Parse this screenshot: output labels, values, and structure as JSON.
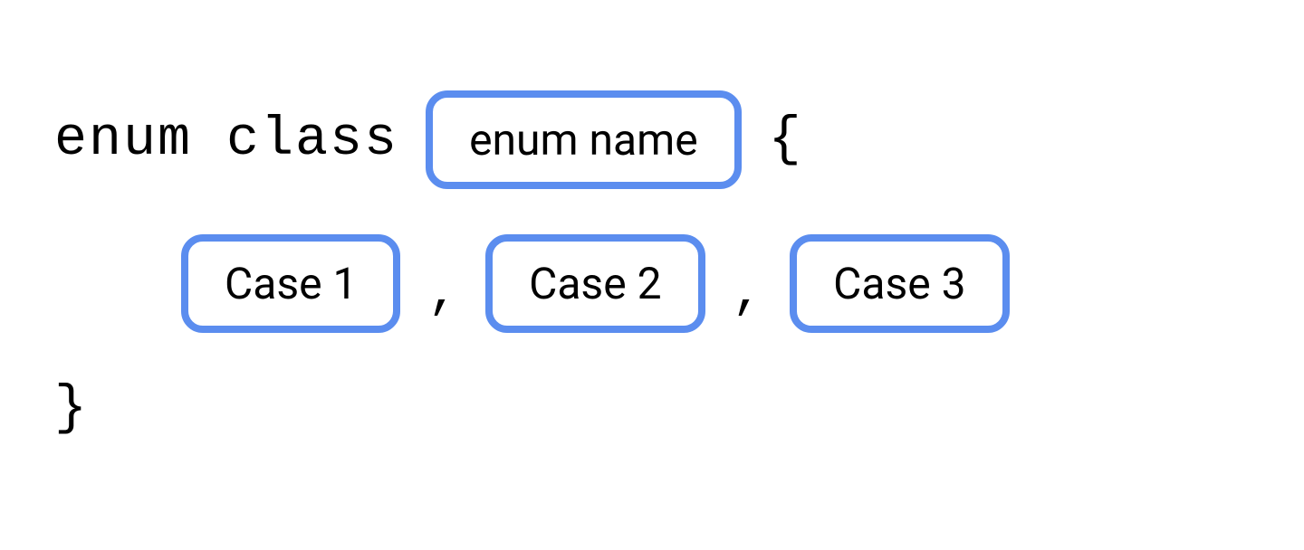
{
  "syntax": {
    "keyword": "enum class",
    "open_brace": "{",
    "close_brace": "}",
    "separator": ","
  },
  "placeholders": {
    "name": "enum name",
    "cases": [
      "Case 1",
      "Case 2",
      "Case 3"
    ]
  }
}
